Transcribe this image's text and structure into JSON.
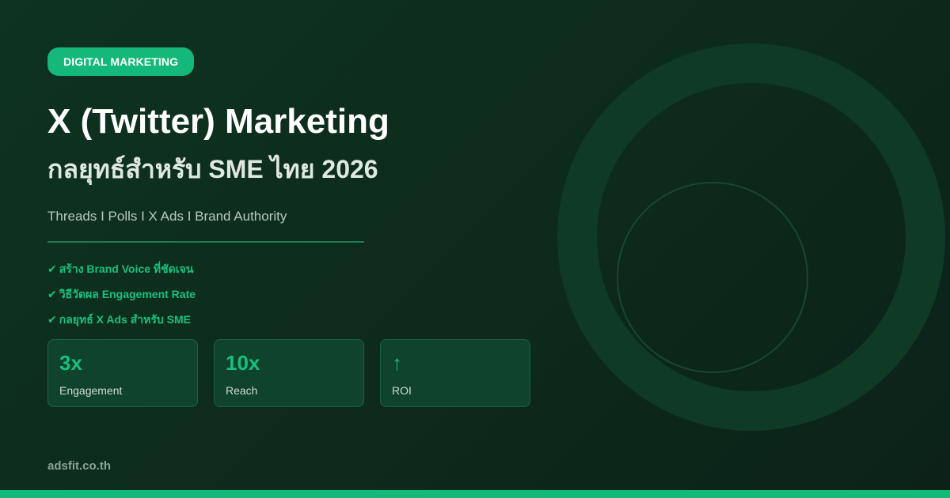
{
  "badge": {
    "label": "DIGITAL MARKETING"
  },
  "heading": {
    "title": "X (Twitter) Marketing",
    "subtitle": "กลยุทธ์สำหรับ SME ไทย 2026"
  },
  "tagline": "Threads I Polls I X Ads I Brand Authority",
  "features": [
    {
      "check": "✔",
      "text": "สร้าง Brand Voice ที่ชัดเจน"
    },
    {
      "check": "✔",
      "text": "วิธีวัดผล Engagement Rate"
    },
    {
      "check": "✔",
      "text": "กลยุทธ์ X Ads สำหรับ SME"
    }
  ],
  "stats": [
    {
      "value": "3x",
      "label": "Engagement"
    },
    {
      "value": "10x",
      "label": "Reach"
    },
    {
      "value": "↑",
      "label": "ROI"
    }
  ],
  "footer": {
    "domain": "adsfit.co.th"
  },
  "colors": {
    "accent": "#14b879",
    "background": "#0d2c1c",
    "card": "#0f432b"
  },
  "icons": {
    "check": "checkmark-icon",
    "roi": "arrow-up-icon"
  }
}
